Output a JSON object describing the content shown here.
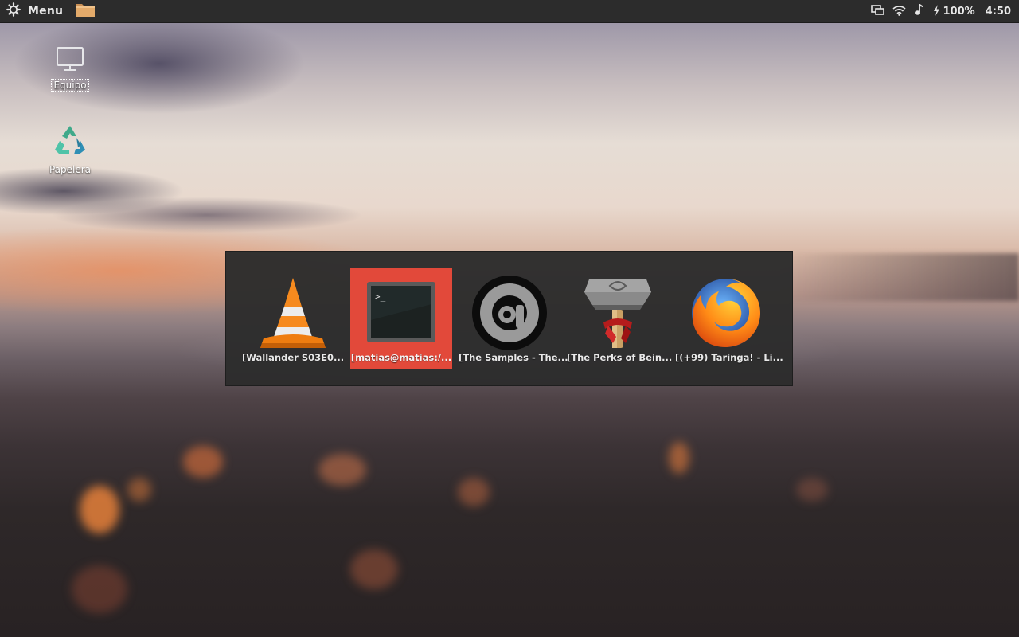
{
  "panel": {
    "menu_label": "Menu",
    "menu_icon": "gear-icon",
    "launchers": [
      {
        "icon": "folder-icon"
      }
    ],
    "tray": {
      "display_icon": "display-icon",
      "wifi_icon": "wifi-icon",
      "volume_icon": "music-note-icon",
      "battery_icon": "lightning-icon",
      "battery_text": "100%",
      "clock": "4:50"
    }
  },
  "desktop": {
    "icons": [
      {
        "label": "Equipo",
        "icon": "monitor-icon",
        "selected": true
      },
      {
        "label": "Papelera",
        "icon": "recycle-bin-icon",
        "selected": false
      }
    ]
  },
  "switcher": {
    "active_index": 1,
    "windows": [
      {
        "title": "[Wallander S03E0...",
        "icon": "vlc-cone-icon"
      },
      {
        "title": "[matias@matias:/...",
        "icon": "terminal-icon"
      },
      {
        "title": "[The Samples - The...",
        "icon": "audacious-icon"
      },
      {
        "title": "[The Perks of Bein...",
        "icon": "book-hammer-icon"
      },
      {
        "title": "[(+99) Taringa! - Li...",
        "icon": "firefox-icon"
      }
    ]
  },
  "colors": {
    "panel_bg": "#2c2c2c",
    "switcher_bg": "#2c2c2c",
    "active_highlight": "#e2493a",
    "text": "#e9e9e9"
  }
}
